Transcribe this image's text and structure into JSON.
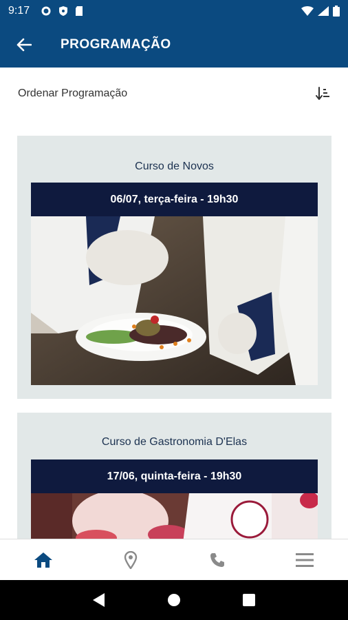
{
  "status_bar": {
    "time": "9:17",
    "left_icons": [
      "gear-icon",
      "shield-icon",
      "sd-card-icon"
    ],
    "right_icons": [
      "wifi-icon",
      "signal-icon",
      "battery-icon"
    ]
  },
  "app_bar": {
    "title": "PROGRAMAÇÃO",
    "back_icon": "arrow-left-icon",
    "background": "#0b4a80"
  },
  "sort_row": {
    "label": "Ordenar Programação",
    "icon": "sort-descending-icon"
  },
  "events": [
    {
      "title": "Curso de Novos",
      "date": "06/07, terça-feira - 19h30"
    },
    {
      "title": "Curso de Gastronomia D'Elas",
      "date": "17/06, quinta-feira - 19h30"
    }
  ],
  "bottom_nav": {
    "items": [
      "home-icon",
      "location-pin-icon",
      "phone-icon",
      "menu-icon"
    ],
    "active_color": "#0b4a80",
    "inactive_color": "#8a8a8a"
  },
  "colors": {
    "card_bg": "#e2e8e8",
    "banner_bg": "#0f1a3e",
    "title_color": "#1b3150"
  }
}
